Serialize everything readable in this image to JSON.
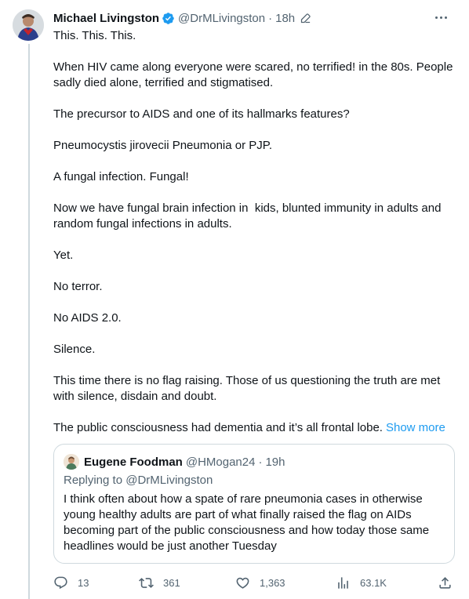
{
  "tweet": {
    "author_name": "Michael Livingston",
    "author_handle": "@DrMLivingston",
    "separator": "·",
    "time": "18h",
    "paragraphs": [
      "This. This. This.",
      "When HIV came along everyone were scared, no terrified! in the 80s. People sadly died alone, terrified and stigmatised.",
      "The precursor to AIDS and one of its hallmarks features?",
      "Pneumocystis jirovecii Pneumonia or PJP.",
      "A fungal infection. Fungal!",
      "Now we have fungal brain infection in  kids, blunted immunity in adults and random fungal infections in adults.",
      "Yet.",
      "No terror.",
      "No AIDS 2.0.",
      "Silence.",
      "This time there is no flag raising. Those of us questioning the truth are met with silence, disdain and doubt."
    ],
    "last_paragraph": "The public consciousness had dementia and it’s all frontal lobe.",
    "show_more": "Show more",
    "icons": {
      "verified": "verified-badge-icon",
      "edit": "edit-pencil-icon",
      "more": "more-options-icon"
    }
  },
  "quote": {
    "author_name": "Eugene Foodman",
    "author_handle": "@HMogan24",
    "separator": "·",
    "time": "19h",
    "replying_prefix": "Replying to",
    "replying_to": "@DrMLivingston",
    "text": "I think often about how a spate of rare pneumonia cases in otherwise young healthy adults are part of what finally raised the flag on AIDs becoming part of the public consciousness and how today those same headlines would be just another Tuesday"
  },
  "actions": {
    "replies": "13",
    "retweets": "361",
    "likes": "1,363",
    "views": "63.1K"
  },
  "colors": {
    "accent": "#1d9bf0",
    "text": "#0f1419",
    "secondary": "#536471",
    "border": "#cfd9de"
  }
}
